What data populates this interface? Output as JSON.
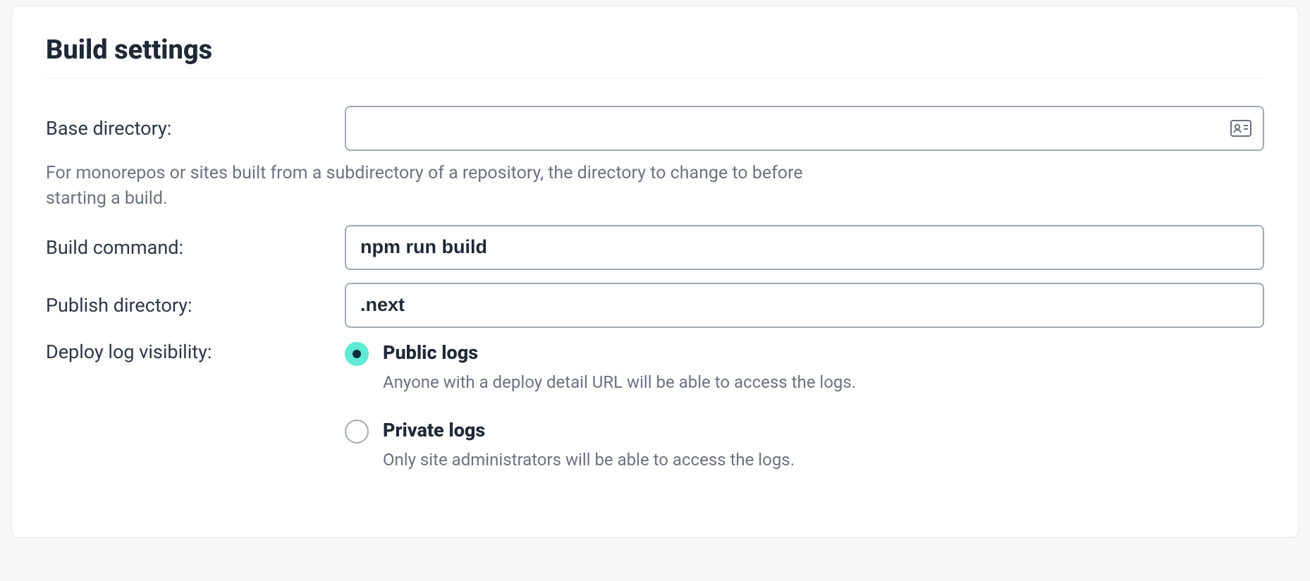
{
  "section": {
    "title": "Build settings"
  },
  "fields": {
    "base_directory": {
      "label": "Base directory:",
      "value": "",
      "help": "For monorepos or sites built from a subdirectory of a repository, the directory to change to before starting a build."
    },
    "build_command": {
      "label": "Build command:",
      "value": "npm run build"
    },
    "publish_directory": {
      "label": "Publish directory:",
      "value": ".next"
    },
    "deploy_log_visibility": {
      "label": "Deploy log visibility:",
      "selected": "public",
      "options": {
        "public": {
          "title": "Public logs",
          "desc": "Anyone with a deploy detail URL will be able to access the logs."
        },
        "private": {
          "title": "Private logs",
          "desc": "Only site administrators will be able to access the logs."
        }
      }
    }
  },
  "icons": {
    "contact_card": "contact-card-icon"
  },
  "colors": {
    "accent": "#5eead4",
    "text": "#1f2937",
    "muted": "#6b7280",
    "border": "#a0aab5"
  }
}
